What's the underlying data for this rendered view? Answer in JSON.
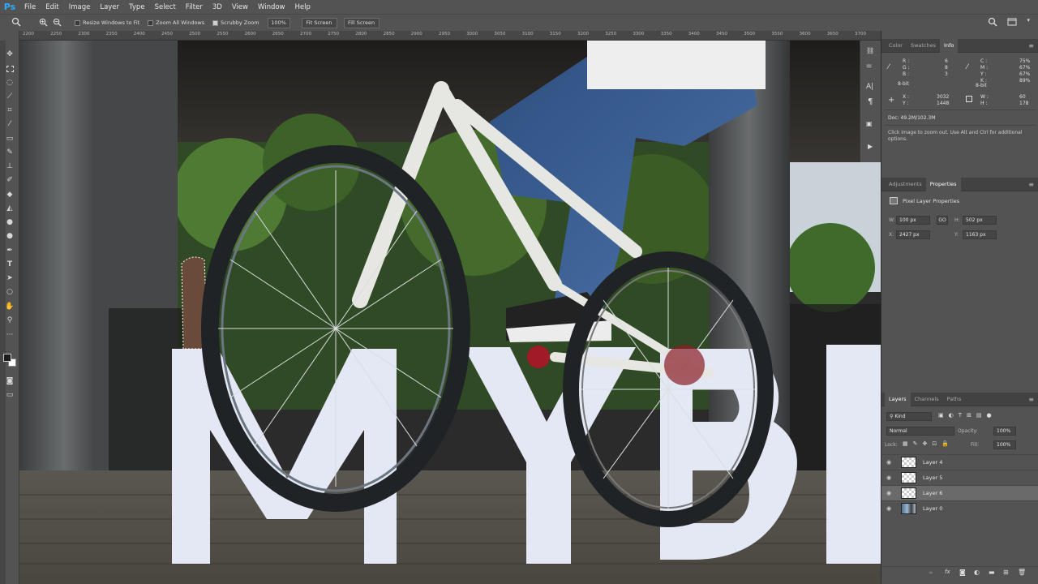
{
  "app": {
    "logo": "Ps"
  },
  "menu": [
    "File",
    "Edit",
    "Image",
    "Layer",
    "Type",
    "Select",
    "Filter",
    "3D",
    "View",
    "Window",
    "Help"
  ],
  "options": {
    "resize_windows": "Resize Windows to Fit",
    "zoom_all": "Zoom All Windows",
    "scrubby_zoom": "Scrubby Zoom",
    "zoom_pct": "100%",
    "fit_screen": "Fit Screen",
    "fill_screen": "Fill Screen"
  },
  "ruler": [
    "2200",
    "2250",
    "2300",
    "2350",
    "2400",
    "2450",
    "2500",
    "2550",
    "2600",
    "2650",
    "2700",
    "2750",
    "2800",
    "2850",
    "2900",
    "2950",
    "3000",
    "3050",
    "3100",
    "3150",
    "3200",
    "3250",
    "3300",
    "3350",
    "3400",
    "3450",
    "3500",
    "3550",
    "3600",
    "3650",
    "3700"
  ],
  "panels": {
    "top_tabs": [
      "Color",
      "Swatches",
      "Info"
    ],
    "info": {
      "r": "R :",
      "r_val": "6",
      "g": "G :",
      "g_val": "8",
      "b": "B :",
      "b_val": "3",
      "c": "C :",
      "c_val": "75%",
      "m": "M :",
      "m_val": "67%",
      "y": "Y :",
      "y_val": "67%",
      "k": "K :",
      "k_val": "89%",
      "bit1": "8-bit",
      "bit2": "8-bit",
      "x": "X :",
      "x_val": "3032",
      "yy": "Y :",
      "yy_val": "1448",
      "w": "W :",
      "w_val": "60",
      "h": "H :",
      "h_val": "178",
      "doc": "Doc: 49.2M/102.3M",
      "hint": "Click image to zoom out. Use Alt and Ctrl for additional options."
    },
    "mid_tabs": [
      "Adjustments",
      "Properties"
    ],
    "properties": {
      "title": "Pixel Layer Properties",
      "w_label": "W:",
      "w": "100 px",
      "h_label": "H:",
      "h": "502 px",
      "x_label": "X:",
      "x": "2427 px",
      "y_label": "Y:",
      "y": "1163 px"
    },
    "layer_tabs": [
      "Layers",
      "Channels",
      "Paths"
    ],
    "layers_panel": {
      "filter": "Kind",
      "blend": "Normal",
      "opacity_label": "Opacity:",
      "opacity": "100%",
      "lock_label": "Lock:",
      "fill_label": "Fill:",
      "fill": "100%",
      "layers": [
        "Layer 4",
        "Layer 5",
        "Layer 6",
        "Layer 0"
      ],
      "selected_index": 2
    }
  },
  "colors": {
    "ui_bg": "#535353",
    "dark": "#282828",
    "accent": "#31a8ff",
    "letters": "#e8ecf7"
  },
  "icons": [
    "zoom-icon",
    "zoom-in-icon",
    "zoom-out-icon",
    "search-icon",
    "workspace-icon",
    "eye-icon",
    "fx-icon",
    "trash-icon"
  ]
}
